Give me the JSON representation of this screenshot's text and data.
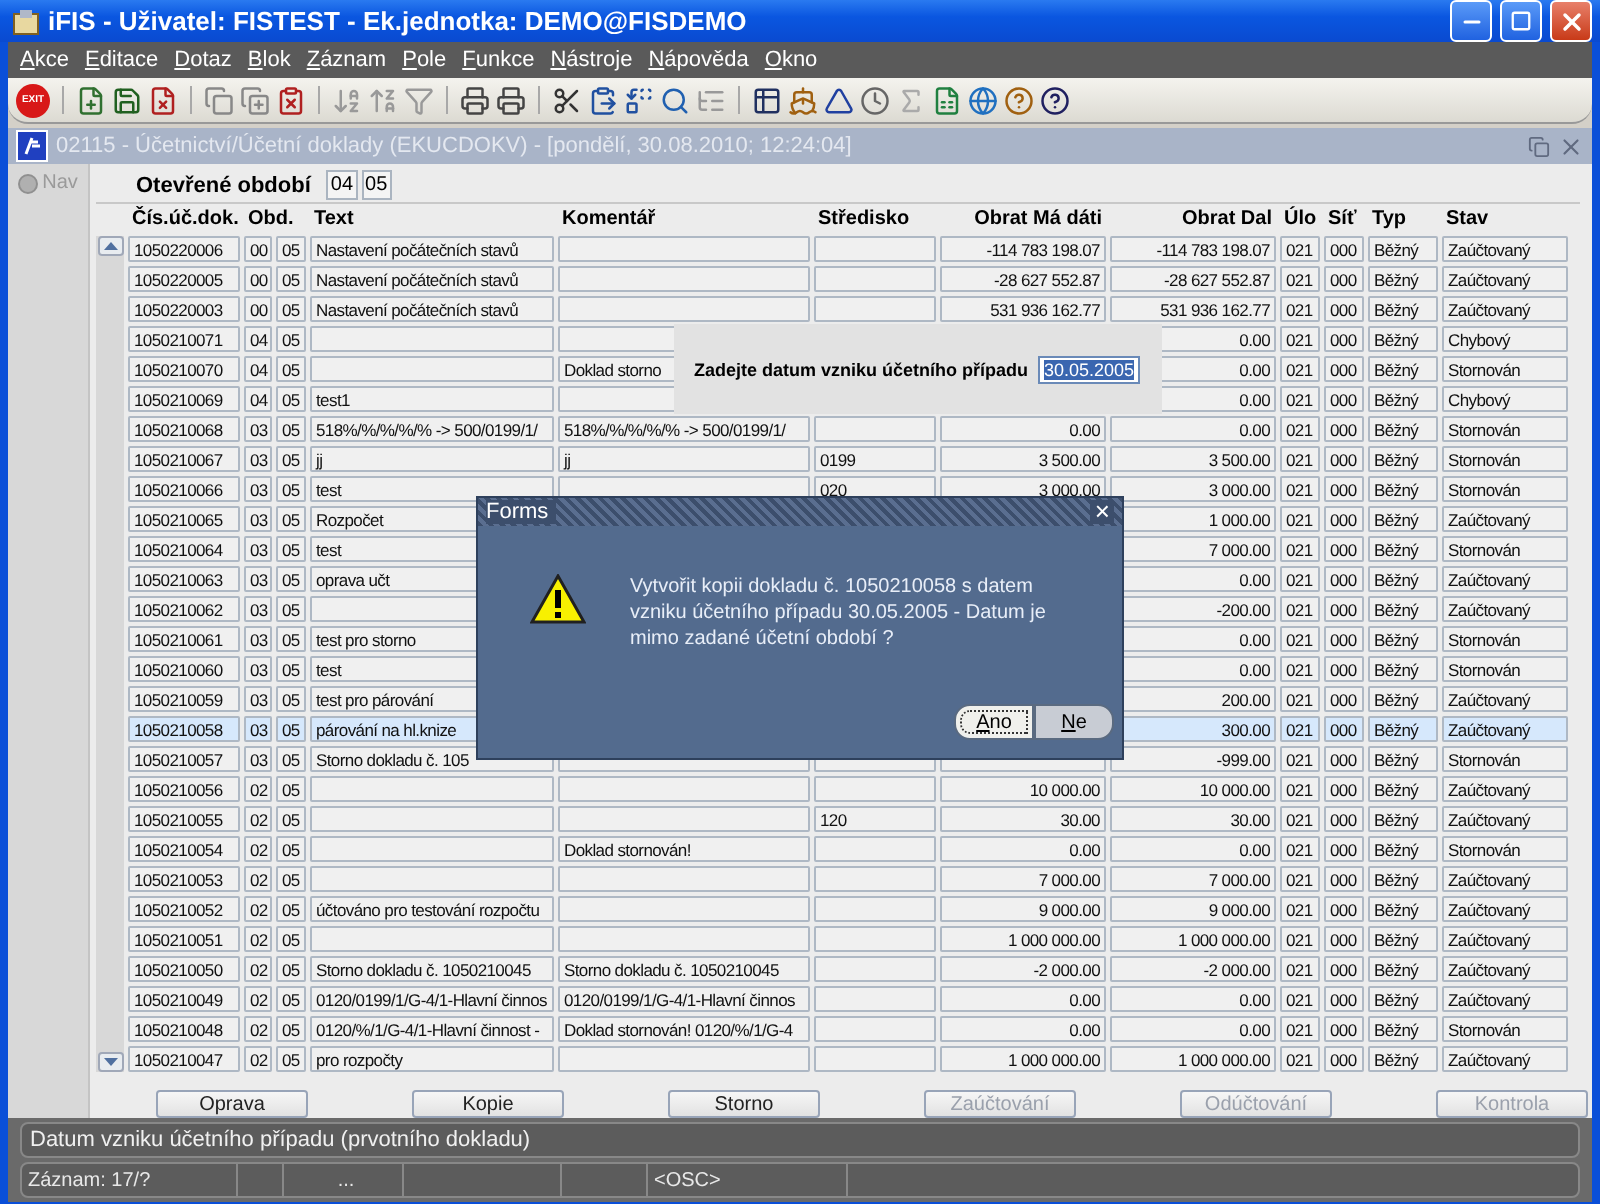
{
  "window": {
    "title": "iFIS - Uživatel: FISTEST - Ek.jednotka: DEMO@FISDEMO"
  },
  "menu": [
    "Akce",
    "Editace",
    "Dotaz",
    "Blok",
    "Záznam",
    "Pole",
    "Funkce",
    "Nástroje",
    "Nápověda",
    "Okno"
  ],
  "toolbar": {
    "exit_label": "EXIT"
  },
  "form": {
    "title": "02115 - Účetnictví/Účetní doklady (EKUCDOKV) - [pondělí, 30.08.2010; 12:24:04]",
    "nav_label": "Nav",
    "period_label": "Otevřené období",
    "period_values": [
      "04",
      "05"
    ]
  },
  "table": {
    "columns": [
      "Čís.úč.dok.",
      "Obd.",
      "Text",
      "Komentář",
      "Středisko",
      "Obrat Má dáti",
      "Obrat Dal",
      "Úlo",
      "Síť",
      "Typ",
      "Stav"
    ],
    "rows": [
      {
        "doc": "1050220006",
        "obd1": "00",
        "obd2": "05",
        "text": "Nastavení počátečních stavů",
        "md": "-114 783 198.07",
        "dal": "-114 783 198.07",
        "ulo": "021",
        "sit": "000",
        "typ": "Běžný",
        "stav": "Zaúčtovaný",
        "selected": false
      },
      {
        "doc": "1050220005",
        "obd1": "00",
        "obd2": "05",
        "text": "Nastavení počátečních stavů",
        "md": "-28 627 552.87",
        "dal": "-28 627 552.87",
        "ulo": "021",
        "sit": "000",
        "typ": "Běžný",
        "stav": "Zaúčtovaný",
        "selected": false
      },
      {
        "doc": "1050220003",
        "obd1": "00",
        "obd2": "05",
        "text": "Nastavení počátečních stavů",
        "md": "531 936 162.77",
        "dal": "531 936 162.77",
        "ulo": "021",
        "sit": "000",
        "typ": "Běžný",
        "stav": "Zaúčtovaný",
        "selected": false
      },
      {
        "doc": "1050210071",
        "obd1": "04",
        "obd2": "05",
        "dal": "0.00",
        "ulo": "021",
        "sit": "000",
        "typ": "Běžný",
        "stav": "Chybový",
        "selected": false
      },
      {
        "doc": "1050210070",
        "obd1": "04",
        "obd2": "05",
        "komentar": "Doklad storno",
        "dal": "0.00",
        "ulo": "021",
        "sit": "000",
        "typ": "Běžný",
        "stav": "Stornován",
        "selected": false
      },
      {
        "doc": "1050210069",
        "obd1": "04",
        "obd2": "05",
        "text": "test1",
        "dal": "0.00",
        "ulo": "021",
        "sit": "000",
        "typ": "Běžný",
        "stav": "Chybový",
        "selected": false
      },
      {
        "doc": "1050210068",
        "obd1": "03",
        "obd2": "05",
        "text": "518%/%/%/%/% -> 500/0199/1/",
        "komentar": "518%/%/%/%/% -> 500/0199/1/",
        "md": "0.00",
        "dal": "0.00",
        "ulo": "021",
        "sit": "000",
        "typ": "Běžný",
        "stav": "Stornován",
        "selected": false
      },
      {
        "doc": "1050210067",
        "obd1": "03",
        "obd2": "05",
        "text": "jj",
        "komentar": "jj",
        "stredisko": "0199",
        "md": "3 500.00",
        "dal": "3 500.00",
        "ulo": "021",
        "sit": "000",
        "typ": "Běžný",
        "stav": "Stornován",
        "selected": false
      },
      {
        "doc": "1050210066",
        "obd1": "03",
        "obd2": "05",
        "text": "test",
        "stredisko": "020",
        "md": "3 000.00",
        "dal": "3 000.00",
        "ulo": "021",
        "sit": "000",
        "typ": "Běžný",
        "stav": "Stornován",
        "selected": false
      },
      {
        "doc": "1050210065",
        "obd1": "03",
        "obd2": "05",
        "text": "Rozpočet",
        "dal": "1 000.00",
        "ulo": "021",
        "sit": "000",
        "typ": "Běžný",
        "stav": "Zaúčtovaný",
        "selected": false
      },
      {
        "doc": "1050210064",
        "obd1": "03",
        "obd2": "05",
        "text": "test",
        "dal": "7 000.00",
        "ulo": "021",
        "sit": "000",
        "typ": "Běžný",
        "stav": "Stornován",
        "selected": false
      },
      {
        "doc": "1050210063",
        "obd1": "03",
        "obd2": "05",
        "text": "oprava učt",
        "dal": "0.00",
        "ulo": "021",
        "sit": "000",
        "typ": "Běžný",
        "stav": "Zaúčtovaný",
        "selected": false
      },
      {
        "doc": "1050210062",
        "obd1": "03",
        "obd2": "05",
        "dal": "-200.00",
        "ulo": "021",
        "sit": "000",
        "typ": "Běžný",
        "stav": "Zaúčtovaný",
        "selected": false
      },
      {
        "doc": "1050210061",
        "obd1": "03",
        "obd2": "05",
        "text": "test pro storno",
        "dal": "0.00",
        "ulo": "021",
        "sit": "000",
        "typ": "Běžný",
        "stav": "Stornován",
        "selected": false
      },
      {
        "doc": "1050210060",
        "obd1": "03",
        "obd2": "05",
        "text": "test",
        "dal": "0.00",
        "ulo": "021",
        "sit": "000",
        "typ": "Běžný",
        "stav": "Stornován",
        "selected": false
      },
      {
        "doc": "1050210059",
        "obd1": "03",
        "obd2": "05",
        "text": "test pro párování",
        "dal": "200.00",
        "ulo": "021",
        "sit": "000",
        "typ": "Běžný",
        "stav": "Zaúčtovaný",
        "selected": false
      },
      {
        "doc": "1050210058",
        "obd1": "03",
        "obd2": "05",
        "text": "párování na hl.knize",
        "dal": "300.00",
        "ulo": "021",
        "sit": "000",
        "typ": "Běžný",
        "stav": "Zaúčtovaný",
        "selected": true
      },
      {
        "doc": "1050210057",
        "obd1": "03",
        "obd2": "05",
        "text": "Storno dokladu č. 105",
        "dal": "-999.00",
        "ulo": "021",
        "sit": "000",
        "typ": "Běžný",
        "stav": "Stornován",
        "selected": false
      },
      {
        "doc": "1050210056",
        "obd1": "02",
        "obd2": "05",
        "md": "10 000.00",
        "dal": "10 000.00",
        "ulo": "021",
        "sit": "000",
        "typ": "Běžný",
        "stav": "Zaúčtovaný",
        "selected": false
      },
      {
        "doc": "1050210055",
        "obd1": "02",
        "obd2": "05",
        "stredisko": "120",
        "md": "30.00",
        "dal": "30.00",
        "ulo": "021",
        "sit": "000",
        "typ": "Běžný",
        "stav": "Zaúčtovaný",
        "selected": false
      },
      {
        "doc": "1050210054",
        "obd1": "02",
        "obd2": "05",
        "komentar": "Doklad stornován!",
        "md": "0.00",
        "dal": "0.00",
        "ulo": "021",
        "sit": "000",
        "typ": "Běžný",
        "stav": "Stornován",
        "selected": false
      },
      {
        "doc": "1050210053",
        "obd1": "02",
        "obd2": "05",
        "md": "7 000.00",
        "dal": "7 000.00",
        "ulo": "021",
        "sit": "000",
        "typ": "Běžný",
        "stav": "Zaúčtovaný",
        "selected": false
      },
      {
        "doc": "1050210052",
        "obd1": "02",
        "obd2": "05",
        "text": "účtováno pro testování rozpočtu",
        "md": "9 000.00",
        "dal": "9 000.00",
        "ulo": "021",
        "sit": "000",
        "typ": "Běžný",
        "stav": "Zaúčtovaný",
        "selected": false
      },
      {
        "doc": "1050210051",
        "obd1": "02",
        "obd2": "05",
        "md": "1 000 000.00",
        "dal": "1 000 000.00",
        "ulo": "021",
        "sit": "000",
        "typ": "Běžný",
        "stav": "Zaúčtovaný",
        "selected": false
      },
      {
        "doc": "1050210050",
        "obd1": "02",
        "obd2": "05",
        "text": "Storno dokladu č. 1050210045",
        "komentar": "Storno dokladu č. 1050210045",
        "md": "-2 000.00",
        "dal": "-2 000.00",
        "ulo": "021",
        "sit": "000",
        "typ": "Běžný",
        "stav": "Zaúčtovaný",
        "selected": false
      },
      {
        "doc": "1050210049",
        "obd1": "02",
        "obd2": "05",
        "text": "0120/0199/1/G-4/1-Hlavní činnos",
        "komentar": "0120/0199/1/G-4/1-Hlavní činnos",
        "md": "0.00",
        "dal": "0.00",
        "ulo": "021",
        "sit": "000",
        "typ": "Běžný",
        "stav": "Zaúčtovaný",
        "selected": false
      },
      {
        "doc": "1050210048",
        "obd1": "02",
        "obd2": "05",
        "text": "0120/%/1/G-4/1-Hlavní činnost -",
        "komentar": "Doklad stornován! 0120/%/1/G-4",
        "md": "0.00",
        "dal": "0.00",
        "ulo": "021",
        "sit": "000",
        "typ": "Běžný",
        "stav": "Stornován",
        "selected": false
      },
      {
        "doc": "1050210047",
        "obd1": "02",
        "obd2": "05",
        "text": "pro rozpočty",
        "md": "1 000 000.00",
        "dal": "1 000 000.00",
        "ulo": "021",
        "sit": "000",
        "typ": "Běžný",
        "stav": "Zaúčtovaný",
        "selected": false
      }
    ]
  },
  "buttons": [
    {
      "label": "Oprava",
      "disabled": false
    },
    {
      "label": "Kopie",
      "disabled": false
    },
    {
      "label": "Storno",
      "disabled": false
    },
    {
      "label": "Zaúčtování",
      "disabled": true
    },
    {
      "label": "Odúčtování",
      "disabled": true
    },
    {
      "label": "Kontrola",
      "disabled": true
    }
  ],
  "date_prompt": {
    "label": "Zadejte datum vzniku účetního případu",
    "value": "30.05.2005"
  },
  "dialog": {
    "title": "Forms",
    "close": "×",
    "message": "Vytvořit kopii dokladu č. 1050210058 s datem vzniku účetního případu 30.05.2005 - Datum je mimo zadané účetní období ?",
    "buttons": [
      {
        "label": "Ano",
        "selected": true
      },
      {
        "label": "Ne",
        "selected": false
      }
    ]
  },
  "status_bar": {
    "hint": "Datum vzniku účetního případu (prvotního dokladu)",
    "record": "Záznam: 17/?",
    "middle": "...",
    "mode": "<OSC>"
  }
}
